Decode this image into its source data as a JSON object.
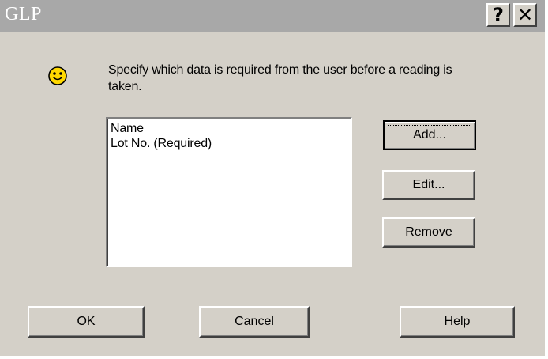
{
  "window": {
    "title": "GLP",
    "help_glyph": "?",
    "close_glyph": "✕"
  },
  "icon": {
    "name": "smiley-icon",
    "color": "#ffd800"
  },
  "description": "Specify which data is required from the user before a reading is taken.",
  "list": {
    "items": [
      "Name",
      "Lot No. (Required)"
    ]
  },
  "side_buttons": {
    "add": "Add...",
    "edit": "Edit...",
    "remove": "Remove"
  },
  "footer_buttons": {
    "ok": "OK",
    "cancel": "Cancel",
    "help": "Help"
  }
}
